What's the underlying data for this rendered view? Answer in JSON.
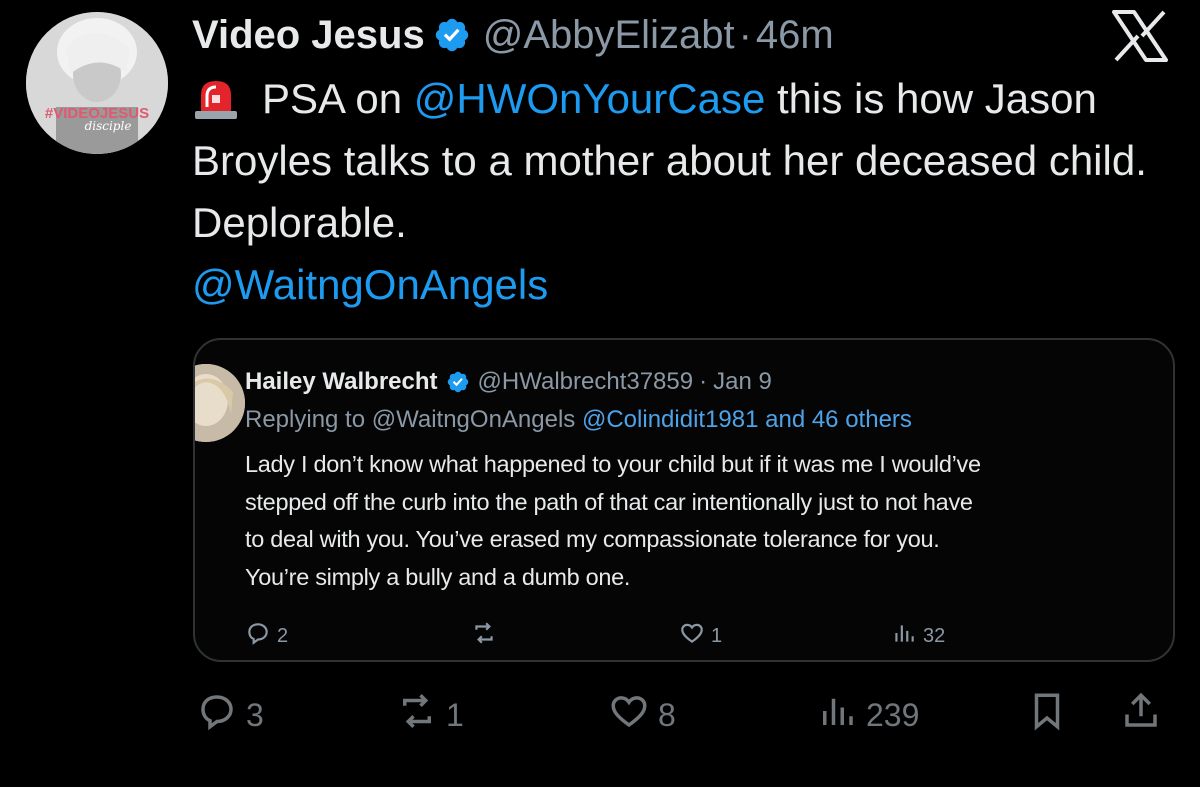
{
  "tweet": {
    "author": {
      "display_name": "Video Jesus",
      "handle": "@AbbyElizabt",
      "avatar_text": "#VIDEOJESUS",
      "avatar_subtext": "disciple"
    },
    "separator": "·",
    "time": "46m",
    "text": {
      "part1": "PSA on ",
      "mention1": "@HWOnYourCase",
      "part2": " this is how Jason Broyles talks to a mother about her deceased child. Deplorable.",
      "mention2": "@WaitngOnAngels"
    },
    "actions": {
      "replies": "3",
      "reposts": "1",
      "likes": "8",
      "views": "239"
    }
  },
  "quoted": {
    "display_name": "Hailey Walbrecht",
    "handle": "@HWalbrecht37859",
    "separator": "·",
    "date": "Jan 9",
    "replying_prefix": "Replying to @WaitngOnAngels ",
    "replying_mentions": "@Colindidit1981 and 46 others",
    "lines": [
      "Lady I don’t know what happened to your child but if it was me I would’ve",
      "stepped off the curb into the path of that car intentionally just to not have",
      "to deal with you. You’ve erased my  compassionate tolerance for you.",
      "You’re simply a bully and a dumb one."
    ],
    "actions": {
      "replies": "2",
      "reposts": "",
      "likes": "1",
      "views": "32"
    }
  },
  "colors": {
    "background": "#000000",
    "text": "#e7e9ea",
    "secondary": "#8b98a5",
    "link": "#1d9bf0",
    "verified": "#1d9bf0"
  },
  "icons": [
    "close-x-icon",
    "verified-badge-icon",
    "siren-emoji-icon",
    "reply-icon",
    "repost-icon",
    "like-icon",
    "views-icon",
    "bookmark-icon",
    "share-icon"
  ]
}
